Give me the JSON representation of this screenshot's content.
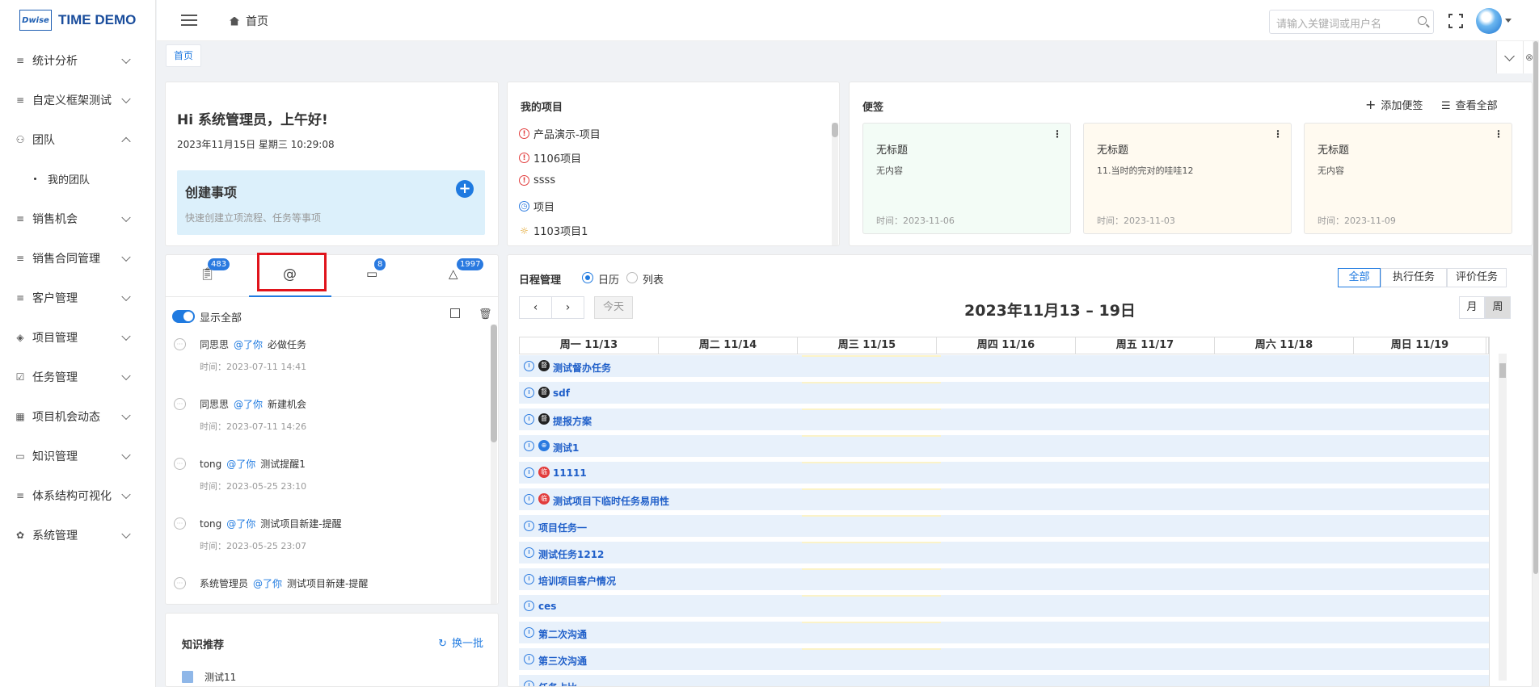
{
  "app": {
    "logo_box": "Dwise",
    "logo_text": "TIME DEMO"
  },
  "sidebar": {
    "items": [
      {
        "label": "统计分析",
        "icon": "list-icon",
        "expanded": false
      },
      {
        "label": "自定义框架测试",
        "icon": "list-icon",
        "expanded": false
      },
      {
        "label": "团队",
        "icon": "team-icon",
        "expanded": true
      },
      {
        "label": "销售机会",
        "icon": "list-icon",
        "expanded": false
      },
      {
        "label": "销售合同管理",
        "icon": "list-icon",
        "expanded": false
      },
      {
        "label": "客户管理",
        "icon": "list-icon",
        "expanded": false
      },
      {
        "label": "项目管理",
        "icon": "layers-icon",
        "expanded": false
      },
      {
        "label": "任务管理",
        "icon": "checkbox-icon",
        "expanded": false
      },
      {
        "label": "项目机会动态",
        "icon": "calendar-icon",
        "expanded": false
      },
      {
        "label": "知识管理",
        "icon": "book-icon",
        "expanded": false
      },
      {
        "label": "体系结构可视化",
        "icon": "list-icon",
        "expanded": false
      },
      {
        "label": "系统管理",
        "icon": "gear-icon",
        "expanded": false
      }
    ],
    "sub_items": {
      "团队": [
        "我的团队"
      ]
    }
  },
  "topbar": {
    "breadcrumb": "首页",
    "search_placeholder": "请输入关键词或用户名"
  },
  "tags": {
    "active": "首页"
  },
  "greeting": {
    "title": "Hi 系统管理员，上午好!",
    "date": "2023年11月15日   星期三   10:29:08",
    "create_title": "创建事项",
    "create_sub": "快速创建立项流程、任务等事项"
  },
  "projects": {
    "title": "我的项目",
    "items": [
      {
        "name": "产品演示-项目",
        "status": "warning"
      },
      {
        "name": "1106项目",
        "status": "warning"
      },
      {
        "name": "ssss",
        "status": "warning"
      },
      {
        "name": "项目",
        "status": "clock"
      },
      {
        "name": "1103项目1",
        "status": "sun"
      }
    ]
  },
  "notes": {
    "title": "便签",
    "add_label": "添加便签",
    "view_all_label": "查看全部",
    "items": [
      {
        "title": "无标题",
        "content": "无内容",
        "time": "时间：2023-11-06",
        "bg": "#f3fcf6"
      },
      {
        "title": "无标题",
        "content": "11.当时的完对的哇哇12",
        "time": "时间：2023-11-03",
        "bg": "#fffaf0"
      },
      {
        "title": "无标题",
        "content": "无内容",
        "time": "时间：2023-11-09",
        "bg": "#fffaf0"
      }
    ]
  },
  "message_tabs": {
    "badges": [
      "483",
      "",
      "8",
      "1997"
    ],
    "show_all_label": "显示全部",
    "messages": [
      {
        "user": "同思思",
        "at": "@了你",
        "content": "必做任务",
        "time": "时间：2023-07-11 14:41"
      },
      {
        "user": "同思思",
        "at": "@了你",
        "content": "新建机会",
        "time": "时间：2023-07-11 14:26"
      },
      {
        "user": "tong",
        "at": "@了你",
        "content": "测试提醒1",
        "time": "时间：2023-05-25 23:10"
      },
      {
        "user": "tong",
        "at": "@了你",
        "content": "测试项目新建-提醒",
        "time": "时间：2023-05-25 23:07"
      },
      {
        "user": "系统管理员",
        "at": "@了你",
        "content": "测试项目新建-提醒",
        "time": ""
      }
    ]
  },
  "knowledge": {
    "title": "知识推荐",
    "refresh": "换一批",
    "items": [
      "测试11"
    ]
  },
  "schedule": {
    "title": "日程管理",
    "view_calendar": "日历",
    "view_list": "列表",
    "prev": "‹",
    "next": "›",
    "today": "今天",
    "range_title": "2023年11月13 – 19日",
    "filters": [
      "全部",
      "执行任务",
      "评价任务"
    ],
    "modes": [
      "月",
      "周"
    ],
    "days": [
      "周一 11/13",
      "周二 11/14",
      "周三 11/15",
      "周四 11/16",
      "周五 11/17",
      "周六 11/18",
      "周日 11/19"
    ],
    "events": [
      {
        "name": "测试督办任务",
        "badge": "督",
        "badge_color": "#222"
      },
      {
        "name": "sdf",
        "badge": "督",
        "badge_color": "#222"
      },
      {
        "name": "提报方案",
        "badge": "督",
        "badge_color": "#222"
      },
      {
        "name": "测试1",
        "badge": "⊕",
        "badge_color": "#2a7ae0"
      },
      {
        "name": "11111",
        "badge": "临",
        "badge_color": "#e23d3d"
      },
      {
        "name": "测试项目下临时任务易用性",
        "badge": "临",
        "badge_color": "#e23d3d"
      },
      {
        "name": "项目任务一",
        "badge": "",
        "badge_color": ""
      },
      {
        "name": "测试任务1212",
        "badge": "",
        "badge_color": ""
      },
      {
        "name": "培训项目客户情况",
        "badge": "",
        "badge_color": ""
      },
      {
        "name": "ces",
        "badge": "",
        "badge_color": ""
      },
      {
        "name": "第二次沟通",
        "badge": "",
        "badge_color": ""
      },
      {
        "name": "第三次沟通",
        "badge": "",
        "badge_color": ""
      },
      {
        "name": "任务占比",
        "badge": "",
        "badge_color": ""
      }
    ]
  }
}
